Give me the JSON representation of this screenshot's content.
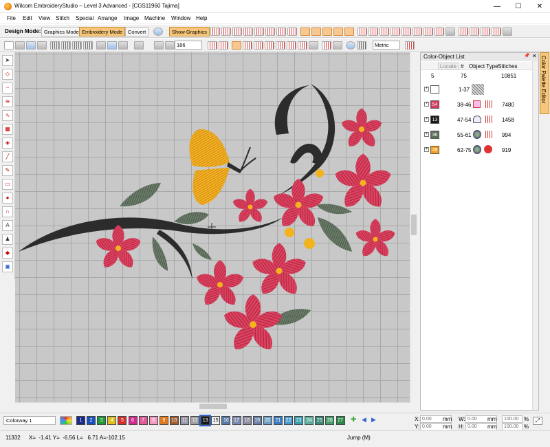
{
  "window": {
    "title": "Wilcom EmbroideryStudio – Level 3 Advanced - [CGS11960        Tajima]",
    "minimize": "—",
    "maximize": "☐",
    "close": "✕"
  },
  "menu": [
    "File",
    "Edit",
    "View",
    "Stitch",
    "Special",
    "Arrange",
    "Image",
    "Machine",
    "Window",
    "Help"
  ],
  "toolbar": {
    "design_mode_label": "Design Mode:",
    "graphics_mode": "Graphics Mode",
    "embroidery_mode": "Embroidery Mode",
    "convert": "Convert",
    "show_graphics": "Show Graphics",
    "zoom_value": "186",
    "units": "Metric"
  },
  "panel": {
    "title": "Color-Object List",
    "columns": {
      "locate": "Locate",
      "num": "#",
      "type": "Object Type",
      "stitches": "Stitches"
    },
    "summary": {
      "colors": "5",
      "objects": "75",
      "stitches": "10851"
    },
    "rows": [
      {
        "swatch": "",
        "color": "#ffffff",
        "range": "1-37",
        "stitches": ""
      },
      {
        "swatch": "54",
        "color": "#d23a5c",
        "range": "38-46",
        "stitches": "7480"
      },
      {
        "swatch": "13",
        "color": "#1a1a1a",
        "range": "47-54",
        "stitches": "1458"
      },
      {
        "swatch": "36",
        "color": "#5c6b5a",
        "range": "55-61",
        "stitches": "994"
      },
      {
        "swatch": "49",
        "color": "#f2a01e",
        "range": "62-75",
        "stitches": "919"
      }
    ],
    "side_tab": "Color Palette Editor"
  },
  "colorway": {
    "label": "Colorway 1"
  },
  "color_wells": [
    {
      "n": "1",
      "c": "#1a2a8a"
    },
    {
      "n": "2",
      "c": "#1a4fbf"
    },
    {
      "n": "3",
      "c": "#1e9a3a"
    },
    {
      "n": "4",
      "c": "#e0c020"
    },
    {
      "n": "5",
      "c": "#d03030"
    },
    {
      "n": "6",
      "c": "#d02a90"
    },
    {
      "n": "7",
      "c": "#e05a9a"
    },
    {
      "n": "8",
      "c": "#f29ac0"
    },
    {
      "n": "9",
      "c": "#e07a20"
    },
    {
      "n": "10",
      "c": "#a06030"
    },
    {
      "n": "11",
      "c": "#9898a8"
    },
    {
      "n": "12",
      "c": "#a0a0a0"
    },
    {
      "n": "13",
      "c": "#1a1a1a"
    },
    {
      "n": "15",
      "c": "#f0f0f0"
    },
    {
      "n": "16",
      "c": "#5a7aa8"
    },
    {
      "n": "17",
      "c": "#7a8ab0"
    },
    {
      "n": "18",
      "c": "#8a8aa0"
    },
    {
      "n": "19",
      "c": "#6a82a8"
    },
    {
      "n": "20",
      "c": "#6aa0c8"
    },
    {
      "n": "21",
      "c": "#3a7ac0"
    },
    {
      "n": "22",
      "c": "#4a9ad0"
    },
    {
      "n": "23",
      "c": "#3aa0b0"
    },
    {
      "n": "24",
      "c": "#5ab0a0"
    },
    {
      "n": "25",
      "c": "#3a8a7a"
    },
    {
      "n": "26",
      "c": "#4aa06a"
    },
    {
      "n": "27",
      "c": "#2a8a4a"
    }
  ],
  "coords": {
    "x_label": "X:",
    "y_label": "Y:",
    "w_label": "W:",
    "h_label": "H:",
    "x": "0.00",
    "y": "0.00",
    "w": "0.00",
    "h": "0.00",
    "unit": "mm",
    "pct_x": "100.00",
    "pct_y": "100.00",
    "pct_unit": "%"
  },
  "status": {
    "count": "11332",
    "pos": "X=  -1.41 Y=  -6.56 L=   6.71 A=-102.15",
    "mode": "Jump (M)"
  }
}
